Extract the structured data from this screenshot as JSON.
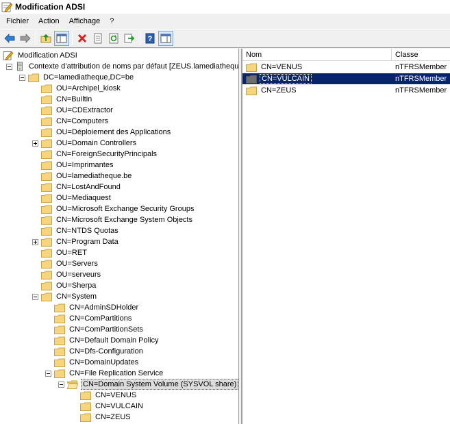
{
  "window": {
    "title": "Modification ADSI"
  },
  "menu": [
    "Fichier",
    "Action",
    "Affichage",
    "?"
  ],
  "toolbar": {
    "buttons": [
      "back-icon",
      "forward-icon",
      "up-folder-icon",
      "show-tree-icon",
      "delete-icon",
      "properties-icon",
      "refresh-icon",
      "export-icon",
      "help-icon",
      "show-panel-icon"
    ]
  },
  "tree": {
    "root": "Modification ADSI",
    "context": "Contexte d’attribution de noms par défaut [ZEUS.lamediatheque",
    "domain": "DC=lamediatheque,DC=be",
    "domain_children": [
      {
        "label": "OU=Archipel_kiosk",
        "expander": false
      },
      {
        "label": "CN=Builtin",
        "expander": false
      },
      {
        "label": "OU=CDExtractor",
        "expander": false
      },
      {
        "label": "CN=Computers",
        "expander": false
      },
      {
        "label": "OU=Déploiement des Applications",
        "expander": false
      },
      {
        "label": "OU=Domain Controllers",
        "expander": true
      },
      {
        "label": "CN=ForeignSecurityPrincipals",
        "expander": false
      },
      {
        "label": "OU=Imprimantes",
        "expander": false
      },
      {
        "label": "OU=lamediatheque.be",
        "expander": false
      },
      {
        "label": "CN=LostAndFound",
        "expander": false
      },
      {
        "label": "OU=Mediaquest",
        "expander": false
      },
      {
        "label": "OU=Microsoft Exchange Security Groups",
        "expander": false
      },
      {
        "label": "CN=Microsoft Exchange System Objects",
        "expander": false
      },
      {
        "label": "CN=NTDS Quotas",
        "expander": false
      },
      {
        "label": "CN=Program Data",
        "expander": true
      },
      {
        "label": "OU=RET",
        "expander": false
      },
      {
        "label": "OU=Servers",
        "expander": false
      },
      {
        "label": "OU=serveurs",
        "expander": false
      },
      {
        "label": "OU=Sherpa",
        "expander": false
      }
    ],
    "system": "CN=System",
    "system_children": [
      "CN=AdminSDHolder",
      "CN=ComPartitions",
      "CN=ComPartitionSets",
      "CN=Default Domain Policy",
      "CN=Dfs-Configuration",
      "CN=DomainUpdates"
    ],
    "frs": "CN=File Replication Service",
    "sysvol": "CN=Domain System Volume (SYSVOL share)",
    "sysvol_children": [
      "CN=VENUS",
      "CN=VULCAIN",
      "CN=ZEUS"
    ]
  },
  "list": {
    "headers": [
      "Nom",
      "Classe"
    ],
    "rows": [
      {
        "name": "CN=VENUS",
        "class": "nTFRSMember",
        "selected": false
      },
      {
        "name": "CN=VULCAIN",
        "class": "nTFRSMember",
        "selected": true
      },
      {
        "name": "CN=ZEUS",
        "class": "nTFRSMember",
        "selected": false
      }
    ]
  },
  "colors": {
    "selection": "#0a246a",
    "folder": "#f5d67e"
  }
}
